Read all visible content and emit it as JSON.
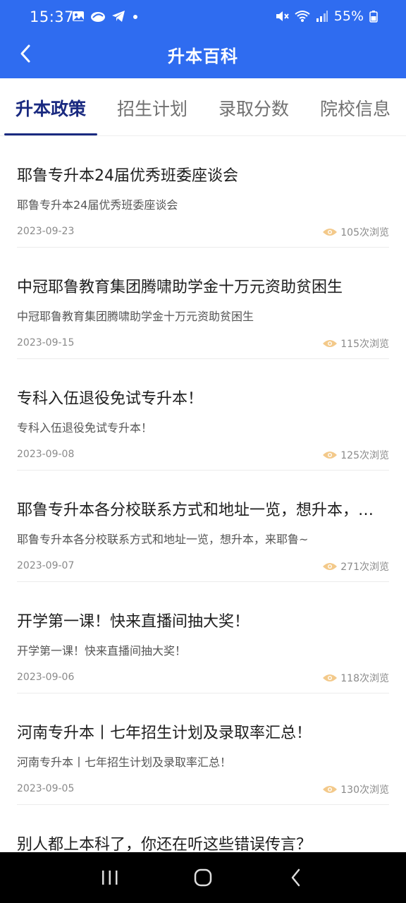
{
  "status_bar": {
    "time": "15:37",
    "battery": "55%",
    "icons": [
      "gallery-icon",
      "cloud-icon",
      "telegram-icon",
      "dot-icon",
      "mute-icon",
      "wifi-icon",
      "signal-icon",
      "battery-icon"
    ]
  },
  "header": {
    "title": "升本百科",
    "back_icon": "chevron-left-icon",
    "color": "#2f6cf0"
  },
  "tabs": [
    {
      "label": "升本政策",
      "active": true
    },
    {
      "label": "招生计划",
      "active": false
    },
    {
      "label": "录取分数",
      "active": false
    },
    {
      "label": "院校信息",
      "active": false
    }
  ],
  "articles": [
    {
      "title": "耶鲁专升本24届优秀班委座谈会",
      "summary": "耶鲁专升本24届优秀班委座谈会",
      "date": "2023-09-23",
      "views": "105次浏览"
    },
    {
      "title": "中冠耶鲁教育集团腾啸助学金十万元资助贫困生",
      "summary": "中冠耶鲁教育集团腾啸助学金十万元资助贫困生",
      "date": "2023-09-15",
      "views": "115次浏览"
    },
    {
      "title": "专科入伍退役免试专升本！",
      "summary": "专科入伍退役免试专升本！",
      "date": "2023-09-08",
      "views": "125次浏览"
    },
    {
      "title": "耶鲁专升本各分校联系方式和地址一览，想升本，来耶鲁~",
      "summary": "耶鲁专升本各分校联系方式和地址一览，想升本，来耶鲁~",
      "date": "2023-09-07",
      "views": "271次浏览"
    },
    {
      "title": "开学第一课！快来直播间抽大奖！",
      "summary": "开学第一课！快来直播间抽大奖！",
      "date": "2023-09-06",
      "views": "118次浏览"
    },
    {
      "title": "河南专升本丨七年招生计划及录取率汇总！",
      "summary": "河南专升本丨七年招生计划及录取率汇总！",
      "date": "2023-09-05",
      "views": "130次浏览"
    },
    {
      "title": "别人都上本科了，你还在听这些错误传言？",
      "summary": "",
      "date": "",
      "views": ""
    }
  ],
  "colors": {
    "accent": "#2f6cf0",
    "tab_active": "#1a2a80",
    "eye_icon": "#f3c98a"
  },
  "system_nav": [
    "recents-icon",
    "home-icon",
    "back-icon"
  ]
}
